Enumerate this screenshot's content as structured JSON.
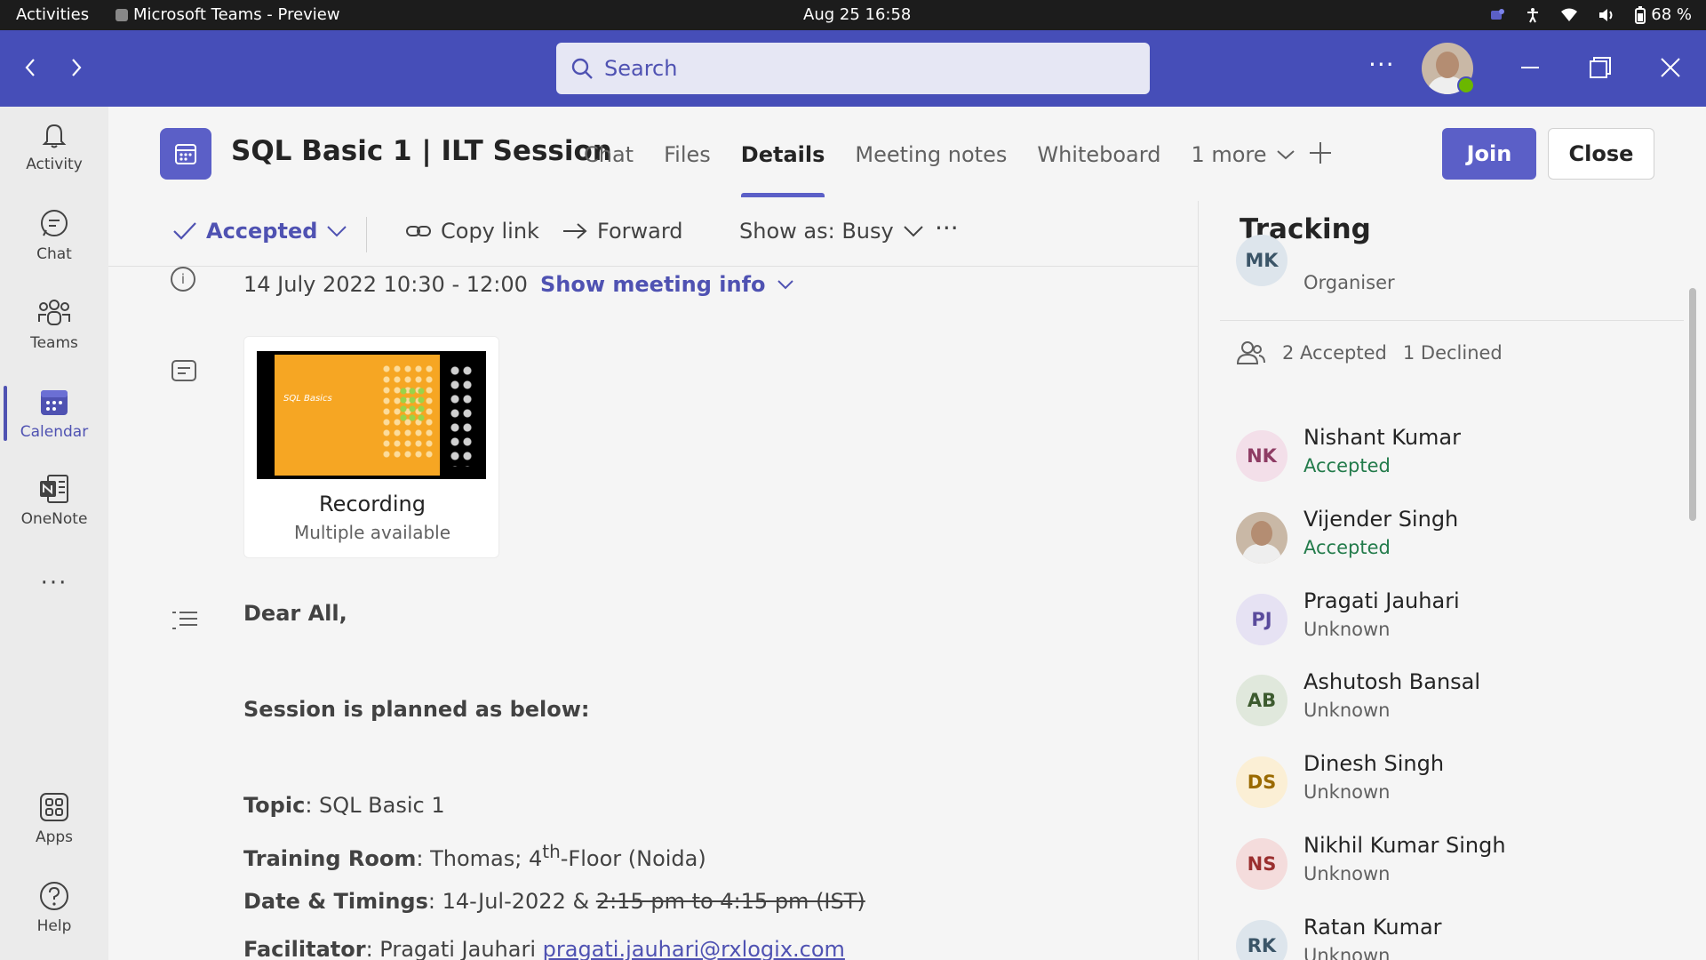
{
  "os_bar": {
    "activities": "Activities",
    "app_name": "Microsoft Teams - Preview",
    "clock": "Aug 25  16:58",
    "battery": "68 %"
  },
  "title_bar": {
    "search_placeholder": "Search",
    "more": "···"
  },
  "rail": {
    "items": [
      {
        "label": "Activity",
        "icon": "bell-icon"
      },
      {
        "label": "Chat",
        "icon": "chat-icon"
      },
      {
        "label": "Teams",
        "icon": "teams-icon"
      },
      {
        "label": "Calendar",
        "icon": "calendar-icon",
        "active": true
      },
      {
        "label": "OneNote",
        "icon": "onenote-icon"
      },
      {
        "label": "···",
        "icon": "more-apps-icon"
      },
      {
        "label": "Apps",
        "icon": "apps-icon"
      },
      {
        "label": "Help",
        "icon": "help-icon"
      }
    ]
  },
  "header": {
    "title": "SQL Basic 1 | ILT Session",
    "tabs": [
      "Chat",
      "Files",
      "Details",
      "Meeting notes",
      "Whiteboard"
    ],
    "active_tab": "Details",
    "more_tab": "1 more",
    "join": "Join",
    "close": "Close"
  },
  "toolbar": {
    "accepted": "Accepted",
    "copy_link": "Copy link",
    "forward": "Forward",
    "show_as": "Show as: Busy",
    "more": "···"
  },
  "meeting": {
    "info_icon": "i",
    "date": "14 July 2022 10:30 - 12:00",
    "show_info": "Show meeting info",
    "recording_title": "Recording",
    "recording_sub": "Multiple available",
    "slide_label": "SQL Basics"
  },
  "body": {
    "greeting": "Dear All,",
    "intro": "Session is planned as below:",
    "topic_label": "Topic",
    "topic_value": ": SQL Basic 1",
    "room_label": "Training Room",
    "room_value_a": ": Thomas; 4",
    "room_sup": "th",
    "room_value_b": "-Floor (Noida)",
    "date_label": "Date & Timings",
    "date_value": ": 14-Jul-2022 & ",
    "date_struck": "2:15 pm to 4:15 pm (IST)",
    "facilitator_label": "Facilitator",
    "facilitator_value": ": Pragati Jauhari ",
    "facilitator_email": "pragati.jauhari@rxlogix.com"
  },
  "tracking": {
    "title": "Tracking",
    "organiser": {
      "initials": "MK",
      "role": "Organiser"
    },
    "accepted_count": "2 Accepted",
    "declined_count": "1 Declined",
    "people": [
      {
        "initials": "NK",
        "name": "Nishant Kumar",
        "status": "Accepted",
        "bg": "#f3dfe9",
        "fg": "#8e3c64",
        "status_color": "#237b4b"
      },
      {
        "initials": "",
        "name": "Vijender Singh",
        "status": "Accepted",
        "bg": "#c9b8a6",
        "fg": "#fff",
        "status_color": "#237b4b",
        "photo": true
      },
      {
        "initials": "PJ",
        "name": "Pragati Jauhari",
        "status": "Unknown",
        "bg": "#e6e2f3",
        "fg": "#5a4b9c",
        "status_color": "#616161"
      },
      {
        "initials": "AB",
        "name": "Ashutosh Bansal",
        "status": "Unknown",
        "bg": "#e0e8dc",
        "fg": "#3c5a2e",
        "status_color": "#616161"
      },
      {
        "initials": "DS",
        "name": "Dinesh Singh",
        "status": "Unknown",
        "bg": "#fbefd5",
        "fg": "#9a6a00",
        "status_color": "#616161"
      },
      {
        "initials": "NS",
        "name": "Nikhil Kumar Singh",
        "status": "Unknown",
        "bg": "#f4dcdc",
        "fg": "#9a2f2f",
        "status_color": "#616161"
      },
      {
        "initials": "RK",
        "name": "Ratan Kumar",
        "status": "Unknown",
        "bg": "#dde5ec",
        "fg": "#3b5568",
        "status_color": "#616161"
      }
    ]
  },
  "colors": {
    "brand": "#464eb8",
    "accent": "#5b5fc7",
    "accepted": "#237b4b"
  }
}
